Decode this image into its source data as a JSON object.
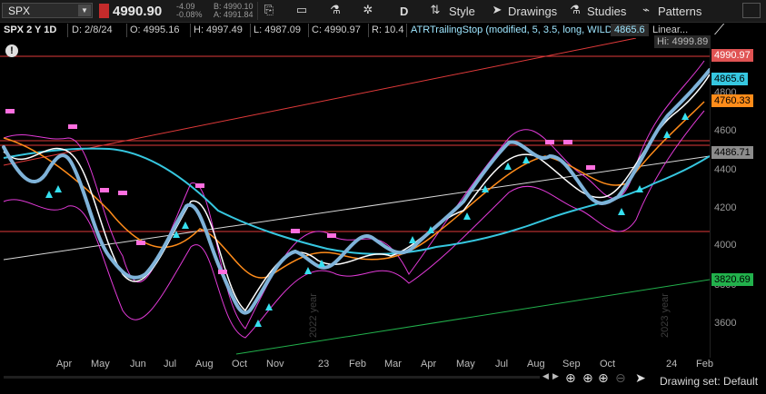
{
  "toolbar": {
    "symbol": "SPX",
    "last_price": "4990.90",
    "change_abs": "-4.09",
    "change_pct": "-0.08%",
    "bid": "B: 4990.10",
    "ask": "A: 4991.84",
    "period": "D",
    "style_label": "Style",
    "drawings_label": "Drawings",
    "studies_label": "Studies",
    "patterns_label": "Patterns"
  },
  "header": {
    "period_label": "SPX 2 Y 1D",
    "date": "D: 2/8/24",
    "open": "O: 4995.16",
    "high": "H: 4997.49",
    "low": "L: 4987.09",
    "close": "C: 4990.97",
    "range": "R: 10.4",
    "study": "ATRTrailingStop (modified, 5, 3.5, long, WILDERS)",
    "study_value": "4865.6",
    "study2": "Linear..."
  },
  "price_axis": {
    "ticks": [
      "4800",
      "4600",
      "4400",
      "4200",
      "4000",
      "3800",
      "3600"
    ],
    "tags": [
      {
        "label": "Hi: 4999.89",
        "color": "#6e6e6e"
      },
      {
        "label": "4990.97",
        "color": "#e05353"
      },
      {
        "label": "4865.6",
        "color": "#36c7e0"
      },
      {
        "label": "4760.33",
        "color": "#ff8c1a"
      },
      {
        "label": "4486.71",
        "color": "#8c8c8c"
      },
      {
        "label": "3820.69",
        "color": "#22b14c"
      }
    ]
  },
  "time_axis": {
    "labels": [
      "Apr",
      "May",
      "Jun",
      "Jul",
      "Aug",
      "Oct",
      "Nov",
      "23",
      "Feb",
      "Mar",
      "Apr",
      "May",
      "Jul",
      "Aug",
      "Sep",
      "Oct",
      "24",
      "Feb"
    ],
    "watermarks": [
      "2022 year",
      "2023 year"
    ]
  },
  "footer": {
    "drawing_set": "Drawing set: Default"
  },
  "colors": {
    "price_line": "#7fb3d9",
    "ema_fast": "#ffffff",
    "ema_mid": "#ff8c1a",
    "ema_slow": "#36c7e0",
    "bands": "#e23ad8",
    "trail_up": "#36e0f0",
    "trail_down": "#ff6fe0",
    "resistance": "#e03a3a",
    "support_line": "#22b14c"
  },
  "icons": {
    "alert": "alert-circle-icon",
    "gear": "gear-icon",
    "flask": "flask-icon",
    "cursor": "cursor-icon",
    "fit": "fit-icon",
    "drawing_tool": "drawing-tool-icon"
  }
}
